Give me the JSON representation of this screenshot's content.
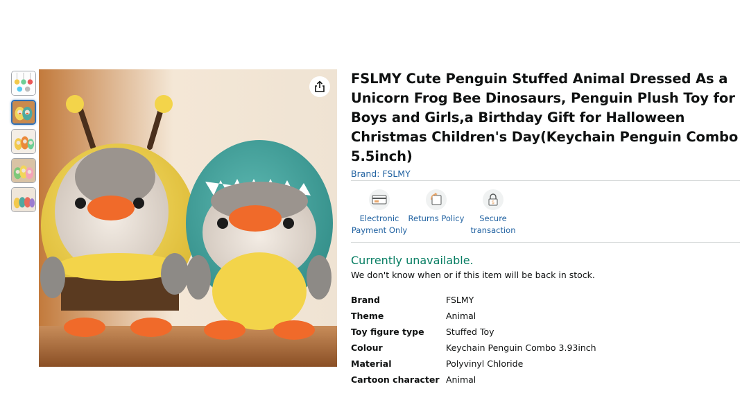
{
  "product": {
    "title": "FSLMY Cute Penguin Stuffed Animal Dressed As a Unicorn Frog Bee Dinosaurs, Penguin Plush Toy for Boys and Girls,a Birthday Gift for Halloween Christmas Children's Day(Keychain Penguin Combo 5.5inch)",
    "brand_link": "Brand: FSLMY"
  },
  "gallery": {
    "thumbnails": [
      {
        "icon": "thumbnail-keychains"
      },
      {
        "icon": "thumbnail-bee-dino"
      },
      {
        "icon": "thumbnail-penguins-2"
      },
      {
        "icon": "thumbnail-penguins-3"
      },
      {
        "icon": "thumbnail-penguins-4"
      }
    ],
    "selected_index": 1,
    "share_icon": "share-icon"
  },
  "features": [
    {
      "label": "Electronic Payment Only",
      "icon": "payment-card-icon"
    },
    {
      "label": "Returns Policy",
      "icon": "returns-icon"
    },
    {
      "label": "Secure transaction",
      "icon": "lock-icon"
    }
  ],
  "availability": {
    "status": "Currently unavailable.",
    "note": "We don't know when or if this item will be back in stock."
  },
  "specs": [
    {
      "key": "Brand",
      "value": "FSLMY"
    },
    {
      "key": "Theme",
      "value": "Animal"
    },
    {
      "key": "Toy figure type",
      "value": "Stuffed Toy"
    },
    {
      "key": "Colour",
      "value": "Keychain Penguin Combo 3.93inch"
    },
    {
      "key": "Material",
      "value": "Polyvinyl Chloride"
    },
    {
      "key": "Cartoon character",
      "value": "Animal"
    }
  ],
  "colors": {
    "link": "#2162a1",
    "availability": "#067d62",
    "divider": "#d5d9d9",
    "selected_thumb_border": "#2f6fb5"
  }
}
